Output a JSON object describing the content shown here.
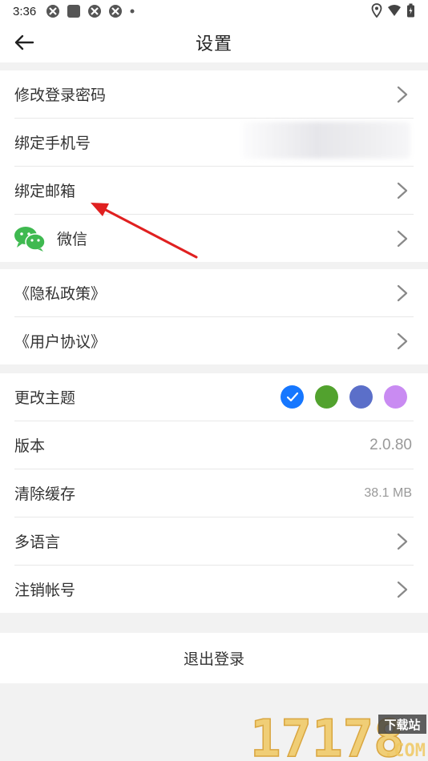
{
  "status_bar": {
    "time": "3:36",
    "left_icons": [
      "app-notification-icon",
      "square-notification-icon",
      "app-notification-icon",
      "app-notification-icon",
      "dot-icon"
    ],
    "right_icons": [
      "location-icon",
      "wifi-icon",
      "battery-icon"
    ]
  },
  "header": {
    "title": "设置",
    "back_icon": "arrow-left-icon"
  },
  "account_group": [
    {
      "label": "修改登录密码",
      "icon": "chevron-right-icon"
    },
    {
      "label": "绑定手机号"
    },
    {
      "label": "绑定邮箱",
      "icon": "chevron-right-icon"
    },
    {
      "label": "微信",
      "leading_icon": "wechat-icon",
      "icon": "chevron-right-icon"
    }
  ],
  "policy_group": [
    {
      "label": "《隐私政策》",
      "icon": "chevron-right-icon"
    },
    {
      "label": "《用户协议》",
      "icon": "chevron-right-icon"
    }
  ],
  "app_group": {
    "theme": {
      "label": "更改主题",
      "colors": [
        "#1677ff",
        "#52a22e",
        "#5b6fc9",
        "#c98bf2"
      ],
      "selected_index": 0
    },
    "version": {
      "label": "版本",
      "value": "2.0.80"
    },
    "cache": {
      "label": "清除缓存",
      "value": "38.1 MB"
    },
    "language": {
      "label": "多语言",
      "icon": "chevron-right-icon"
    },
    "deactivate": {
      "label": "注销帐号",
      "icon": "chevron-right-icon"
    }
  },
  "logout": {
    "label": "退出登录"
  },
  "annotation": {
    "type": "red-arrow",
    "color": "#e02020"
  },
  "watermark": {
    "number": "17178",
    "badge": "下载站",
    "suffix": ".COM"
  }
}
